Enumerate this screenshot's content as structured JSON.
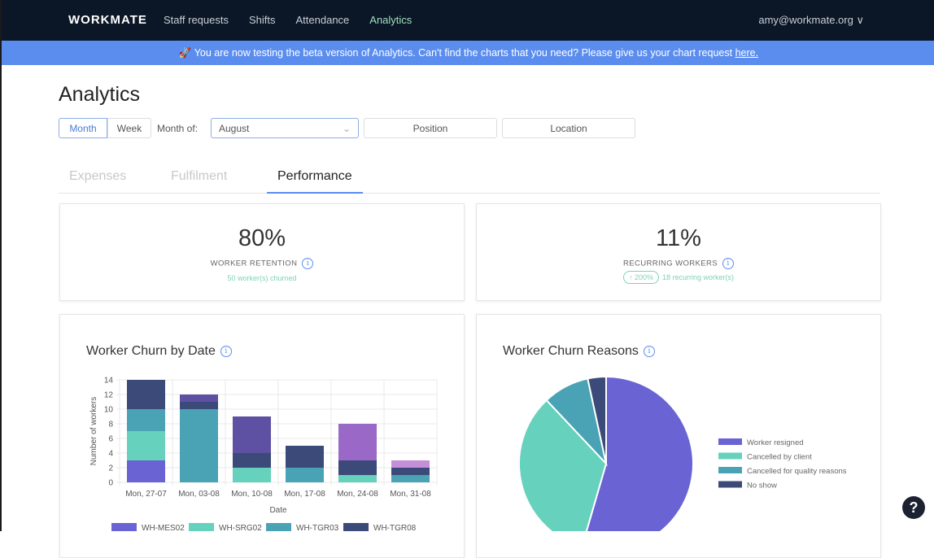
{
  "nav": {
    "logo": "WORKMATE",
    "links": [
      "Staff requests",
      "Shifts",
      "Attendance",
      "Analytics"
    ],
    "active": "Analytics",
    "user": "amy@workmate.org"
  },
  "banner": {
    "text": "🚀 You are now testing the beta version of Analytics. Can't find the charts that you need? Please give us your chart request ",
    "link": "here."
  },
  "page": {
    "title": "Analytics"
  },
  "filters": {
    "month": "Month",
    "week": "Week",
    "month_of": "Month of:",
    "month_value": "August",
    "position": "Position",
    "location": "Location"
  },
  "tabs": [
    "Expenses",
    "Fulfilment",
    "Performance"
  ],
  "kpis": {
    "retention": {
      "value": "80%",
      "label": "WORKER RETENTION",
      "sub": "50 worker(s) churned"
    },
    "recurring": {
      "value": "11%",
      "label": "RECURRING WORKERS",
      "badge": "↑ 200%",
      "sub": "18 recurring worker(s)"
    }
  },
  "colors": {
    "accent": "#5b8def",
    "nav": "#0b1626",
    "positive": "#7fd3b3"
  },
  "help": "?",
  "chart_data": [
    {
      "type": "bar",
      "stacked": true,
      "title": "Worker Churn by Date",
      "xlabel": "Date",
      "ylabel": "Number of workers",
      "ylim": [
        0,
        14
      ],
      "yticks": [
        0,
        2,
        4,
        6,
        8,
        10,
        12,
        14
      ],
      "grid": true,
      "legend": "bottom",
      "categories": [
        "Mon, 27-07",
        "Mon, 03-08",
        "Mon, 10-08",
        "Mon, 17-08",
        "Mon, 24-08",
        "Mon, 31-08"
      ],
      "series": [
        {
          "name": "WH-MES02",
          "color": "#6a63d4",
          "values": [
            3,
            0,
            0,
            0,
            0,
            0
          ]
        },
        {
          "name": "WH-SRG02",
          "color": "#66d1bc",
          "values": [
            4,
            0,
            2,
            0,
            1,
            0
          ]
        },
        {
          "name": "WH-TGR03",
          "color": "#4aa3b5",
          "values": [
            3,
            10,
            0,
            2,
            0,
            1
          ]
        },
        {
          "name": "WH-TGR08",
          "color": "#3b4a78",
          "values": [
            4,
            1,
            2,
            3,
            2,
            1
          ]
        },
        {
          "color": "#5e51a3",
          "values": [
            0,
            1,
            5,
            0,
            0,
            0
          ]
        },
        {
          "color": "#9a68c6",
          "values": [
            0,
            0,
            0,
            0,
            5,
            0
          ]
        },
        {
          "color": "#c48fd8",
          "values": [
            0,
            0,
            0,
            0,
            0,
            1
          ]
        }
      ]
    },
    {
      "type": "pie",
      "title": "Worker Churn Reasons",
      "legend": "right",
      "labels": [
        "Worker resigned",
        "Cancelled by client",
        "Cancelled for quality reasons",
        "No show"
      ],
      "values": [
        54.5,
        33.5,
        8.6,
        3.4
      ],
      "colors": [
        "#6a63d4",
        "#66d1bc",
        "#4aa3b5",
        "#3b4a78"
      ]
    }
  ]
}
